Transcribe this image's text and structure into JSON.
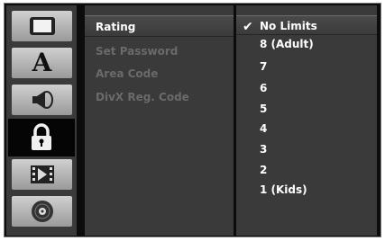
{
  "sidebar": {
    "icons": [
      "display-icon",
      "language-icon",
      "audio-icon",
      "lock-icon",
      "video-recording-icon",
      "disc-icon"
    ],
    "active_index": 3,
    "language_glyph": "A"
  },
  "menu": {
    "items": [
      {
        "label": "Rating",
        "selected": true
      },
      {
        "label": "Set Password",
        "selected": false
      },
      {
        "label": "Area Code",
        "selected": false
      },
      {
        "label": "DivX Reg. Code",
        "selected": false
      }
    ]
  },
  "options": {
    "check_glyph": "✔",
    "selected_index": 0,
    "items": [
      "No Limits",
      "8 (Adult)",
      "7",
      "6",
      "5",
      "4",
      "3",
      "2",
      "1 (Kids)"
    ]
  },
  "colors": {
    "panel": "#3a3a3a",
    "selected_text": "#ffffff",
    "disabled_text": "#6a6a6a"
  }
}
